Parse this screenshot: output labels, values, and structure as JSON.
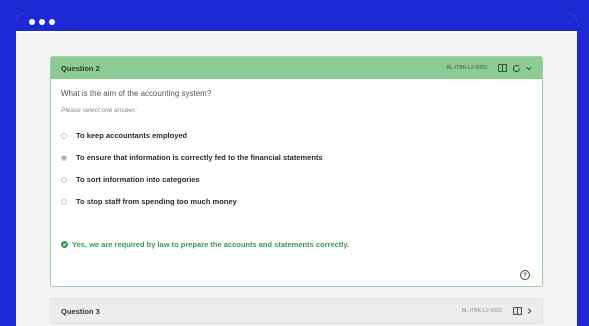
{
  "question2": {
    "title": "Question 2",
    "code": "BL-ITBK-L2-0002",
    "question_text": "What is the aim of the accounting system?",
    "instruction": "Please select one answer:",
    "options": [
      {
        "label": "To keep accountants employed",
        "selected": false
      },
      {
        "label": "To ensure that information is correctly fed to the financial statements",
        "selected": true
      },
      {
        "label": "To sort information into categories",
        "selected": false
      },
      {
        "label": "To stop staff from spending too much money",
        "selected": false
      }
    ],
    "feedback": "Yes, we are required by law to prepare the accounts and statements correctly."
  },
  "question3": {
    "title": "Question 3",
    "code": "BL-ITBK-L2-0003"
  },
  "colors": {
    "page_bg": "#1e29d6",
    "header_green": "#8ccb91",
    "feedback_green": "#3c9b4a"
  },
  "icons": [
    "dot-icon",
    "columns-icon",
    "refresh-icon",
    "chevron-down-icon",
    "chevron-right-icon",
    "check-circle-icon",
    "help-icon"
  ]
}
